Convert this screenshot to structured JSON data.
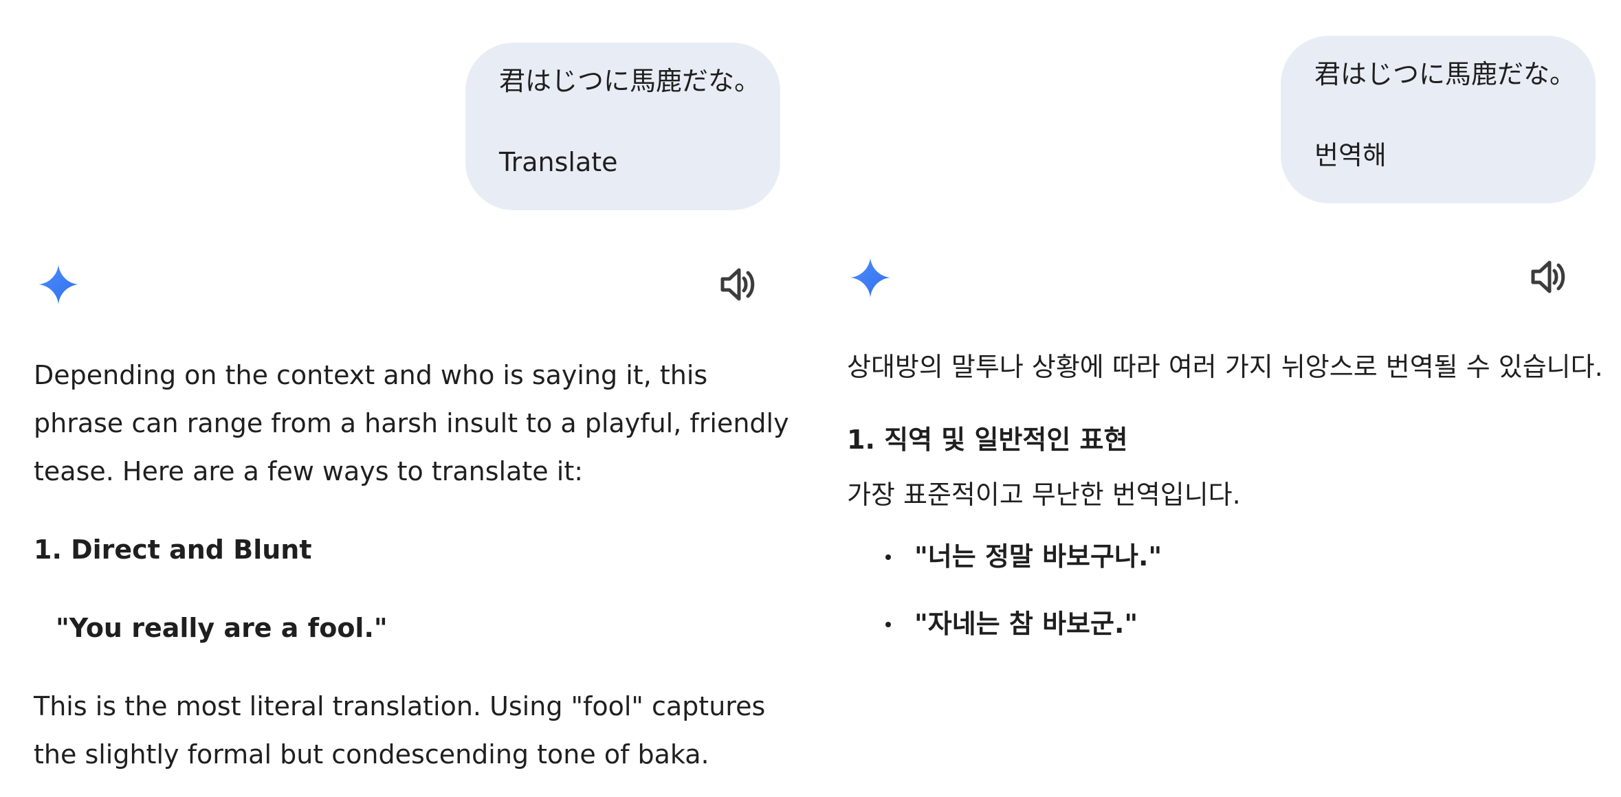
{
  "left": {
    "user_message": {
      "line1": "君はじつに馬鹿だな。",
      "line2": "Translate"
    },
    "icons": {
      "assistant": "gemini-sparkle-icon",
      "speaker": "speaker-volume-icon"
    },
    "response": {
      "intro": "Depending on the context and who is saying it, this phrase can range from a harsh insult to a playful, friendly tease. Here are a few ways to translate it:",
      "section1_heading": "1. Direct and Blunt",
      "section1_quote": "\"You really are a fool.\"",
      "section1_text": "This is the most literal translation. Using \"fool\" captures the slightly formal but condescending tone of baka."
    }
  },
  "right": {
    "user_message": {
      "line1": "君はじつに馬鹿だな。",
      "line2": "번역해"
    },
    "icons": {
      "assistant": "gemini-sparkle-icon",
      "speaker": "speaker-volume-icon"
    },
    "response": {
      "intro": "상대방의 말투나 상황에 따라 여러 가지 뉘앙스로 번역될 수 있습니다.",
      "section1_heading": "1. 직역 및 일반적인 표현",
      "section1_text": "가장 표준적이고 무난한 번역입니다.",
      "bullets": [
        "\"너는 정말 바보구나.\"",
        "\"자네는 참 바보군.\""
      ]
    }
  },
  "colors": {
    "bubble_bg": "#e8edf5",
    "text": "#1f1f1f",
    "gemini_blue": "#4285f4"
  }
}
